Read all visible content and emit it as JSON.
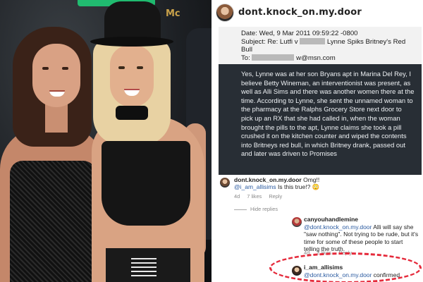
{
  "post": {
    "username": "dont.knock_on.my.door",
    "email": {
      "date_line": "Date: Wed, 9 Mar 2011 09:59:22 -0800",
      "subject_prefix": "Subject: Re: Lutfi v",
      "subject_rest": "Lynne Spiks Britney's Red",
      "subject_end": "Bull",
      "to_prefix": "To:",
      "to_suffix": "w@msn.com",
      "body": "Yes, Lynne was at her son Bryans apt in Marina Del Rey,  I believe Betty Wineman, an interventionist was present, as well as Alli Sims and there was another women there at the time.  According to Lynne, she sent the unnamed woman to the pharmacy at the Ralphs Grocery Store next door to pick up an RX that she had called in, when the woman brought the pills to the apt, Lynne claims she took a pill crushed it on the kitchen counter and wiped the contents into Britneys red bull, in which Britney drank, passed out and later was driven to Promises"
    },
    "comments": [
      {
        "user": "dont.knock_on.my.door",
        "text": "Omg!!",
        "mention": "@i_am_allisims",
        "text2": "Is this true!? 😳",
        "age": "4d",
        "likes": "7 likes",
        "reply": "Reply"
      },
      {
        "hide_replies": "Hide replies"
      },
      {
        "user": "canyouhandlemine",
        "mention": "@dont.knock_on.my.door",
        "text": "Alli will say she \"saw nothing\". Not trying to be rude, but it's time for some of these people to start telling the truth.",
        "age": "4d",
        "likes": "2 likes",
        "reply": "Reply"
      },
      {
        "user": "i_am_allisims",
        "mention": "@dont.knock_on.my.door",
        "text": "confirmed"
      }
    ],
    "highlight_color": "#e52a3b"
  },
  "photo": {
    "background_sign": "Mc"
  }
}
